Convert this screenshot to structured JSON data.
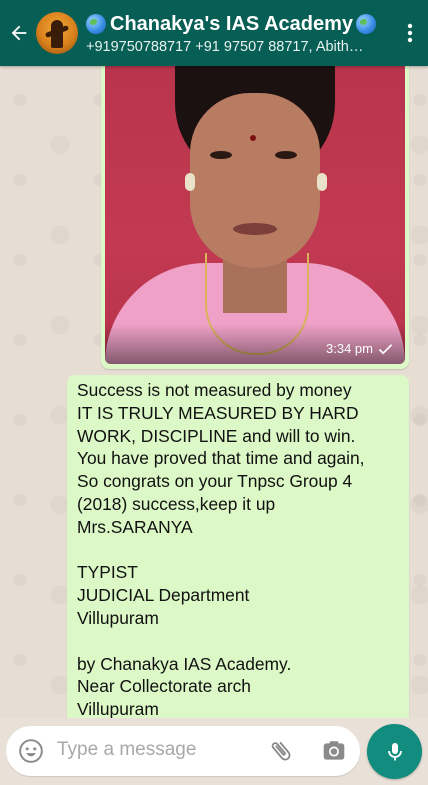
{
  "header": {
    "title": "Chanakya's IAS Academy",
    "subtitle": "+919750788717 +91 97507 88717, Abith…",
    "back_icon": "arrow-left-icon",
    "menu_icon": "more-vert-icon",
    "title_decoration_icon": "globe-icon",
    "bar_color": "#075e54"
  },
  "photo_message": {
    "time": "3:34 pm",
    "status_icon": "check-icon"
  },
  "text_message": {
    "lines": [
      "Success is not measured by money",
      "IT IS TRULY MEASURED BY HARD",
      "WORK, DISCIPLINE and will to win.",
      "You have proved that time and again,",
      "So congrats on your Tnpsc Group 4",
      "(2018) success,keep it up",
      "Mrs.SARANYA",
      "",
      "TYPIST",
      "JUDICIAL Department",
      "Villupuram",
      "",
      "by Chanakya IAS Academy.",
      "Near Collectorate arch",
      "Villupuram"
    ],
    "bubble_color": "#dcf8c6"
  },
  "composer": {
    "placeholder": "Type a message",
    "emoji_icon": "emoji-icon",
    "attach_icon": "paperclip-icon",
    "camera_icon": "camera-icon",
    "mic_icon": "mic-icon",
    "mic_button_color": "#128c7e"
  }
}
